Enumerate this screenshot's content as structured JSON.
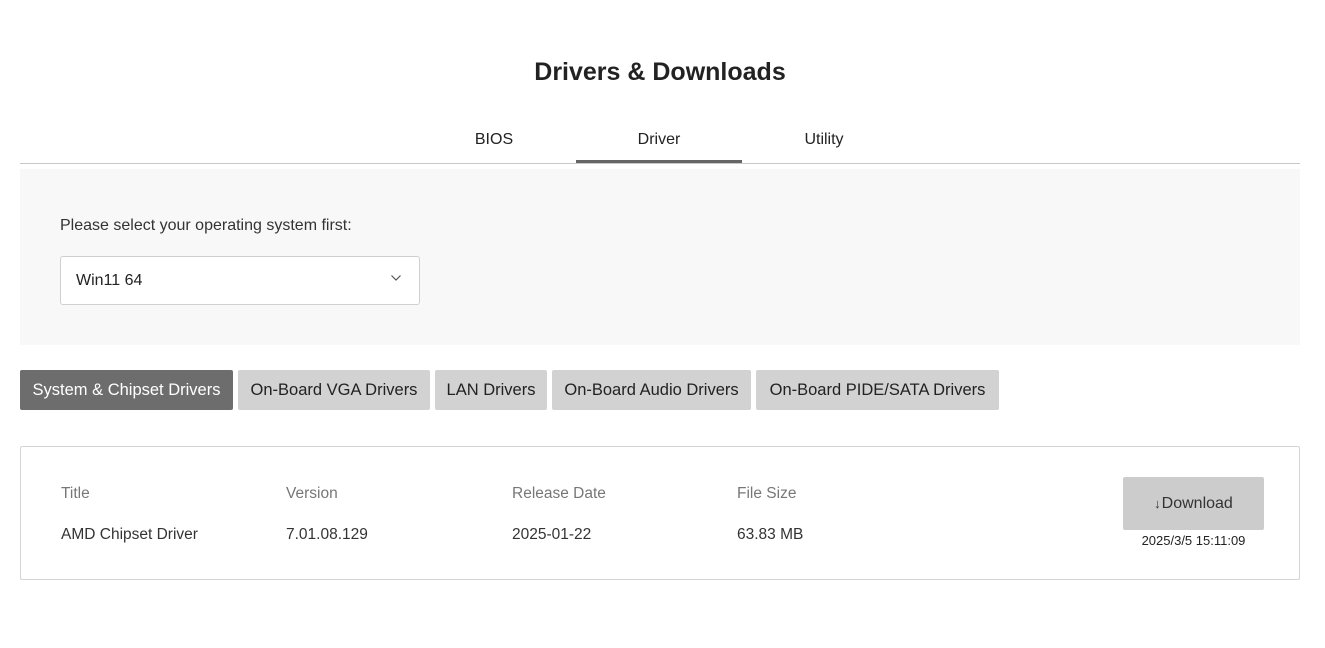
{
  "page": {
    "title": "Drivers & Downloads"
  },
  "tabs": [
    {
      "label": "BIOS",
      "active": false
    },
    {
      "label": "Driver",
      "active": true
    },
    {
      "label": "Utility",
      "active": false
    }
  ],
  "os_selector": {
    "label": "Please select your operating system first:",
    "selected": "Win11 64"
  },
  "categories": [
    {
      "label": "System & Chipset Drivers",
      "active": true
    },
    {
      "label": "On-Board VGA Drivers",
      "active": false
    },
    {
      "label": "LAN Drivers",
      "active": false
    },
    {
      "label": "On-Board Audio Drivers",
      "active": false
    },
    {
      "label": "On-Board PIDE/SATA Drivers",
      "active": false
    }
  ],
  "driver_table": {
    "headers": {
      "title": "Title",
      "version": "Version",
      "release_date": "Release Date",
      "file_size": "File Size"
    },
    "rows": [
      {
        "title": "AMD Chipset Driver",
        "version": "7.01.08.129",
        "release_date": "2025-01-22",
        "file_size": "63.83 MB",
        "download_label": "Download",
        "download_icon": "download-arrow-icon",
        "timestamp": "2025/3/5 15:11:09"
      }
    ]
  },
  "colors": {
    "active_category_bg": "#6d6d6d",
    "category_bg": "#d2d2d2",
    "panel_bg": "#f8f8f8",
    "download_btn_bg": "#cccccc",
    "active_tab_underline": "#666666"
  }
}
